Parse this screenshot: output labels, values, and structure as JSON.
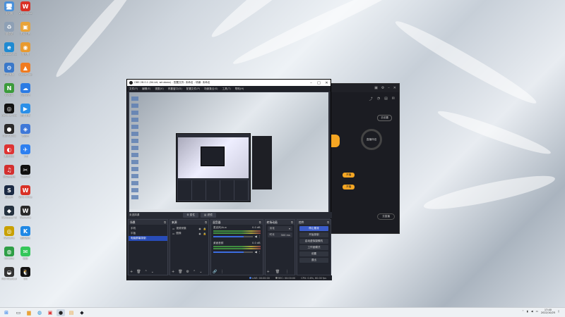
{
  "desktop": {
    "icons": [
      {
        "label": "此电脑",
        "color": "#4a90d9",
        "glyph": "🖥"
      },
      {
        "label": "WPS Office",
        "color": "#d93025",
        "glyph": "W"
      },
      {
        "label": "回收站",
        "color": "#8ea0b5",
        "glyph": "♻"
      },
      {
        "label": "图片工具",
        "color": "#e8a33a",
        "glyph": "▣"
      },
      {
        "label": "Microsoft Edge",
        "color": "#1f8ad2",
        "glyph": "e"
      },
      {
        "label": "猫头鹰",
        "color": "#e89a30",
        "glyph": "◉"
      },
      {
        "label": "控制面板",
        "color": "#3a78c9",
        "glyph": "⚙"
      },
      {
        "label": "Xunlei App",
        "color": "#f07b20",
        "glyph": "▲"
      },
      {
        "label": "NVIDIA",
        "color": "#3b9b3b",
        "glyph": "N"
      },
      {
        "label": "百度网盘",
        "color": "#2b7be4",
        "glyph": "☁"
      },
      {
        "label": "GeForce Experience",
        "color": "#111",
        "glyph": "◎"
      },
      {
        "label": "迅雷影音",
        "color": "#2a8fe8",
        "glyph": "▶"
      },
      {
        "label": "OBS Studio",
        "color": "#2a2a2a",
        "glyph": "●"
      },
      {
        "label": "看图王",
        "color": "#3f78d8",
        "glyph": "◈"
      },
      {
        "label": "腾讯会议",
        "color": "#d33",
        "glyph": "◐"
      },
      {
        "label": "飞书",
        "color": "#2d7ff0",
        "glyph": "✈"
      },
      {
        "label": "网易云音乐",
        "color": "#d32f2f",
        "glyph": "♫"
      },
      {
        "label": "CapCut",
        "color": "#111",
        "glyph": "✂"
      },
      {
        "label": "Steam",
        "color": "#1b2a44",
        "glyph": "S"
      },
      {
        "label": "WPS Office",
        "color": "#d93025",
        "glyph": "W"
      },
      {
        "label": "Wallpaper Engine",
        "color": "#24313f",
        "glyph": "◆"
      },
      {
        "label": "WeGame",
        "color": "#2a2a2a",
        "glyph": "W"
      },
      {
        "label": "WeGame",
        "color": "#c8a000",
        "glyph": "◎"
      },
      {
        "label": "酷狗音乐",
        "color": "#1e88e5",
        "glyph": "K"
      },
      {
        "label": "Chrome",
        "color": "#2e9e46",
        "glyph": "◍"
      },
      {
        "label": "微信",
        "color": "#34c759",
        "glyph": "✉"
      },
      {
        "label": "MSI Afterburner",
        "color": "#333",
        "glyph": "◒"
      },
      {
        "label": "QQ",
        "color": "#111",
        "glyph": "🐧"
      }
    ]
  },
  "obs": {
    "title": "OBS 28.0.1 (64-bit, windows) - 配置文件: 未命名 - 场景: 未命名",
    "menu": [
      "文件(F)",
      "编辑(E)",
      "视图(V)",
      "停靠窗口(D)",
      "配置文件(P)",
      "场景集合(S)",
      "工具(T)",
      "帮助(H)"
    ],
    "scene_bar_label": "未选择源",
    "scene_tabs": [
      "属性",
      "滤镜"
    ],
    "docks": {
      "scenes": {
        "title": "场景",
        "items": [
          "手机",
          "平板",
          "电脑屏幕录制"
        ],
        "selected": 2
      },
      "sources": {
        "title": "来源",
        "items": [
          "视频采集",
          "图像"
        ]
      },
      "mixer": {
        "title": "混音器",
        "channels": [
          {
            "name": "麦克风/Aux",
            "db": "0.0 dB",
            "level": 0.78
          },
          {
            "name": "桌面音频",
            "db": "0.0 dB",
            "level": 0.78
          }
        ]
      },
      "transitions": {
        "title": "转场动画",
        "type": "淡化",
        "duration_label": "时长",
        "duration": "300 ms"
      },
      "controls": {
        "title": "控件",
        "buttons": [
          "停止推流",
          "开始录制",
          "启动虚拟摄像机",
          "工作室模式",
          "设置",
          "退出"
        ]
      }
    },
    "status": {
      "live": "LIVE: 00:00:00",
      "rec": "REC: 00:00:00",
      "cpu": "CPU: 0.6%, 60.00 fps"
    }
  },
  "side_app": {
    "badge": "去设置",
    "center_label": "直播伴侣",
    "orange_buttons": [
      "开播",
      "开播"
    ],
    "bottom_button": "去直播"
  },
  "taskbar": {
    "time": "17:40",
    "date": "2022/10/25"
  }
}
